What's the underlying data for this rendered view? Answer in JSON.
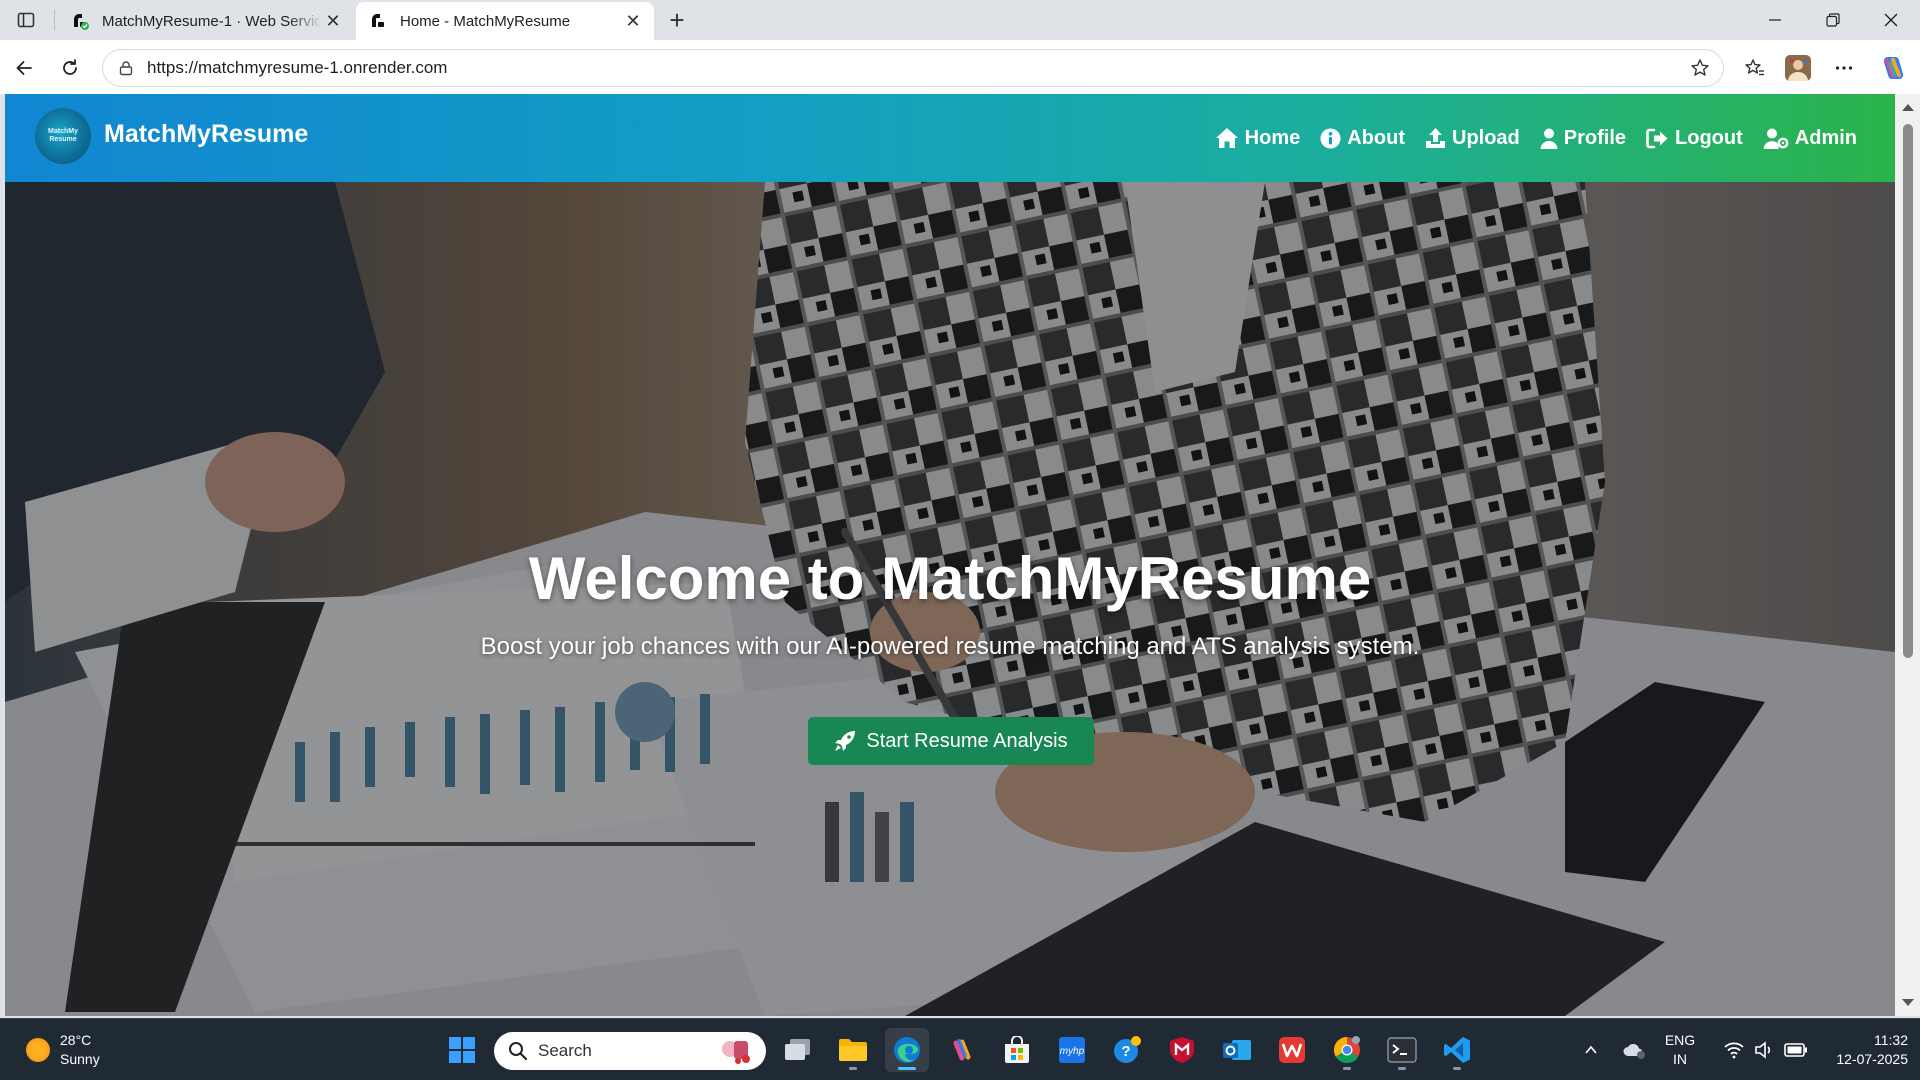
{
  "browser": {
    "tabs": [
      {
        "title": "MatchMyResume-1 · Web Service",
        "active": false,
        "favicon": "render-icon"
      },
      {
        "title": "Home - MatchMyResume",
        "active": true,
        "favicon": "render-icon"
      }
    ],
    "url": "https://matchmyresume-1.onrender.com"
  },
  "site": {
    "brand": "MatchMyResume",
    "logo_text": "MatchMy Resume",
    "nav": [
      {
        "label": "Home",
        "icon": "home-icon"
      },
      {
        "label": "About",
        "icon": "info-icon"
      },
      {
        "label": "Upload",
        "icon": "upload-icon"
      },
      {
        "label": "Profile",
        "icon": "user-icon"
      },
      {
        "label": "Logout",
        "icon": "logout-icon"
      },
      {
        "label": "Admin",
        "icon": "admin-icon"
      }
    ],
    "hero": {
      "title": "Welcome to MatchMyResume",
      "subtitle": "Boost your job chances with our AI-powered resume matching and ATS analysis system.",
      "cta_label": "Start Resume Analysis",
      "cta_icon": "rocket-icon"
    }
  },
  "taskbar": {
    "weather_temp": "28°C",
    "weather_desc": "Sunny",
    "search_placeholder": "Search",
    "lang_top": "ENG",
    "lang_bottom": "IN",
    "time": "11:32",
    "date": "12-07-2025"
  },
  "colors": {
    "nav_gradient_start": "#1186d2",
    "nav_gradient_end": "#2bb34a",
    "cta": "#198754",
    "taskbar": "#202a35"
  }
}
